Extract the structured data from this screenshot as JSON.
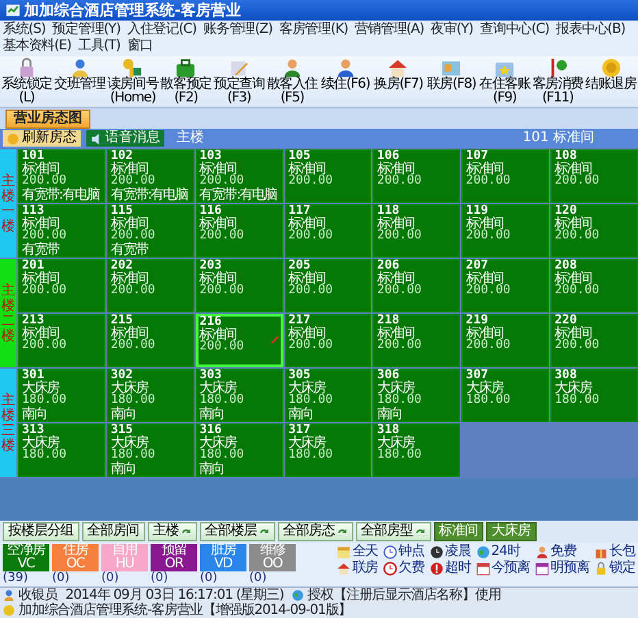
{
  "window": {
    "title": "加加综合酒店管理系统-客房营业"
  },
  "menu": [
    "系统(S)",
    "预定管理(Y)",
    "入住登记(C)",
    "账务管理(Z)",
    "客房管理(K)",
    "营销管理(A)",
    "夜审(Y)",
    "查询中心(C)",
    "报表中心(B)",
    "基本资料(E)",
    "工具(T)",
    "窗口"
  ],
  "toolbar": [
    "系统锁定(L)",
    "交班管理",
    "读房间号(Home)",
    "散客预定(F2)",
    "预定查询(F3)",
    "散客入住(F5)",
    "续住(F6)",
    "换房(F7)",
    "联房(F8)",
    "在住客账(F9)",
    "客房消费(F11)",
    "结账退房"
  ],
  "tabs": [
    {
      "label": "营业房态图",
      "selected": true
    }
  ],
  "header": {
    "refresh": "刷新房态",
    "voice": "语音消息",
    "building": "主楼",
    "current_room": "101 标准间"
  },
  "floors": [
    {
      "label": "主楼一楼",
      "color": "#1ec8f0",
      "rows": [
        [
          {
            "number": "101",
            "type": "标准间",
            "price": "200.00",
            "note": "有宽带:有电脑",
            "selected": false
          },
          {
            "number": "102",
            "type": "标准间",
            "price": "200.00",
            "note": "有宽带:有电脑",
            "selected": false
          },
          {
            "number": "103",
            "type": "标准间",
            "price": "200.00",
            "note": "有宽带:有电脑",
            "selected": false
          },
          {
            "number": "105",
            "type": "标准间",
            "price": "200.00",
            "selected": false
          },
          {
            "number": "106",
            "type": "标准间",
            "price": "200.00",
            "selected": false
          },
          {
            "number": "107",
            "type": "标准间",
            "price": "200.00",
            "selected": false
          },
          {
            "number": "108",
            "type": "标准间",
            "price": "200.00",
            "selected": false
          }
        ],
        [
          {
            "number": "113",
            "type": "标准间",
            "price": "200.00",
            "note": "有宽带",
            "selected": false
          },
          {
            "number": "115",
            "type": "标准间",
            "price": "200.00",
            "note": "有宽带",
            "selected": false
          },
          {
            "number": "116",
            "type": "标准间",
            "price": "200.00",
            "selected": false
          },
          {
            "number": "117",
            "type": "标准间",
            "price": "200.00",
            "selected": false
          },
          {
            "number": "118",
            "type": "标准间",
            "price": "200.00",
            "selected": false
          },
          {
            "number": "119",
            "type": "标准间",
            "price": "200.00",
            "selected": false
          },
          {
            "number": "120",
            "type": "标准间",
            "price": "200.00",
            "selected": false
          }
        ]
      ]
    },
    {
      "label": "主楼二楼",
      "color": "#12e012",
      "rows": [
        [
          {
            "number": "201",
            "type": "标准间",
            "price": "200.00",
            "selected": false
          },
          {
            "number": "202",
            "type": "标准间",
            "price": "200.00",
            "selected": false
          },
          {
            "number": "203",
            "type": "标准间",
            "price": "200.00",
            "selected": false
          },
          {
            "number": "205",
            "type": "标准间",
            "price": "200.00",
            "selected": false
          },
          {
            "number": "206",
            "type": "标准间",
            "price": "200.00",
            "selected": false
          },
          {
            "number": "207",
            "type": "标准间",
            "price": "200.00",
            "selected": false
          },
          {
            "number": "208",
            "type": "标准间",
            "price": "200.00",
            "selected": false
          }
        ],
        [
          {
            "number": "213",
            "type": "标准间",
            "price": "200.00",
            "selected": false
          },
          {
            "number": "215",
            "type": "标准间",
            "price": "200.00",
            "selected": false
          },
          {
            "number": "216",
            "type": "标准间",
            "price": "200.00",
            "selected": true
          },
          {
            "number": "217",
            "type": "标准间",
            "price": "200.00",
            "selected": false
          },
          {
            "number": "218",
            "type": "标准间",
            "price": "200.00",
            "selected": false
          },
          {
            "number": "219",
            "type": "标准间",
            "price": "200.00",
            "selected": false
          },
          {
            "number": "220",
            "type": "标准间",
            "price": "200.00",
            "selected": false
          }
        ]
      ]
    },
    {
      "label": "主楼三楼",
      "color": "#1ec8f0",
      "rows": [
        [
          {
            "number": "301",
            "type": "大床房",
            "price": "180.00",
            "note": "南向",
            "selected": false
          },
          {
            "number": "302",
            "type": "大床房",
            "price": "180.00",
            "note": "南向",
            "selected": false
          },
          {
            "number": "303",
            "type": "大床房",
            "price": "180.00",
            "note": "南向",
            "selected": false
          },
          {
            "number": "305",
            "type": "大床房",
            "price": "180.00",
            "note": "南向",
            "selected": false
          },
          {
            "number": "306",
            "type": "大床房",
            "price": "180.00",
            "note": "南向",
            "selected": false
          },
          {
            "number": "307",
            "type": "大床房",
            "price": "180.00",
            "selected": false
          },
          {
            "number": "308",
            "type": "大床房",
            "price": "180.00",
            "selected": false
          }
        ],
        [
          {
            "number": "313",
            "type": "大床房",
            "price": "180.00",
            "selected": false
          },
          {
            "number": "315",
            "type": "大床房",
            "price": "180.00",
            "note": "南向",
            "selected": false
          },
          {
            "number": "316",
            "type": "大床房",
            "price": "180.00",
            "note": "南向",
            "selected": false
          },
          {
            "number": "317",
            "type": "大床房",
            "price": "180.00",
            "selected": false
          },
          {
            "number": "318",
            "type": "大床房",
            "price": "180.00",
            "selected": false
          }
        ]
      ]
    }
  ],
  "filters": [
    {
      "label": "按楼层分组",
      "kind": "button"
    },
    {
      "label": "全部房间",
      "kind": "button"
    },
    {
      "label": "主楼",
      "kind": "dropdown"
    },
    {
      "label": "全部楼层",
      "kind": "dropdown"
    },
    {
      "label": "全部房态",
      "kind": "dropdown"
    },
    {
      "label": "全部房型",
      "kind": "dropdown"
    },
    {
      "label": "标准间",
      "kind": "type"
    },
    {
      "label": "大床房",
      "kind": "type"
    }
  ],
  "statuses": [
    {
      "label": "空净房",
      "code": "VC",
      "count": "(39)",
      "color": "#0d7a0d"
    },
    {
      "label": "住房",
      "code": "OC",
      "count": "(0)",
      "color": "#f58040"
    },
    {
      "label": "自用",
      "code": "HU",
      "count": "(0)",
      "color": "#f7a8c8"
    },
    {
      "label": "预留",
      "code": "OR",
      "count": "(0)",
      "color": "#8a1890"
    },
    {
      "label": "脏房",
      "code": "VD",
      "count": "(0)",
      "color": "#2a86e8"
    },
    {
      "label": "维修",
      "code": "OO",
      "count": "(0)",
      "color": "#8c8c8c"
    }
  ],
  "legend": [
    "全天",
    "钟点",
    "凌晨",
    "24时",
    "免费",
    "长包",
    "联房",
    "欠费",
    "超时",
    "今预离",
    "明预离",
    "锁定"
  ],
  "status_bar": [
    "收银员",
    "2014年 09月 03日 16:17:01 (星期三)",
    "授权【注册后显示酒店名称】使用",
    "加加综合酒店管理系统-客房营业【增强版2014-09-01版】"
  ]
}
